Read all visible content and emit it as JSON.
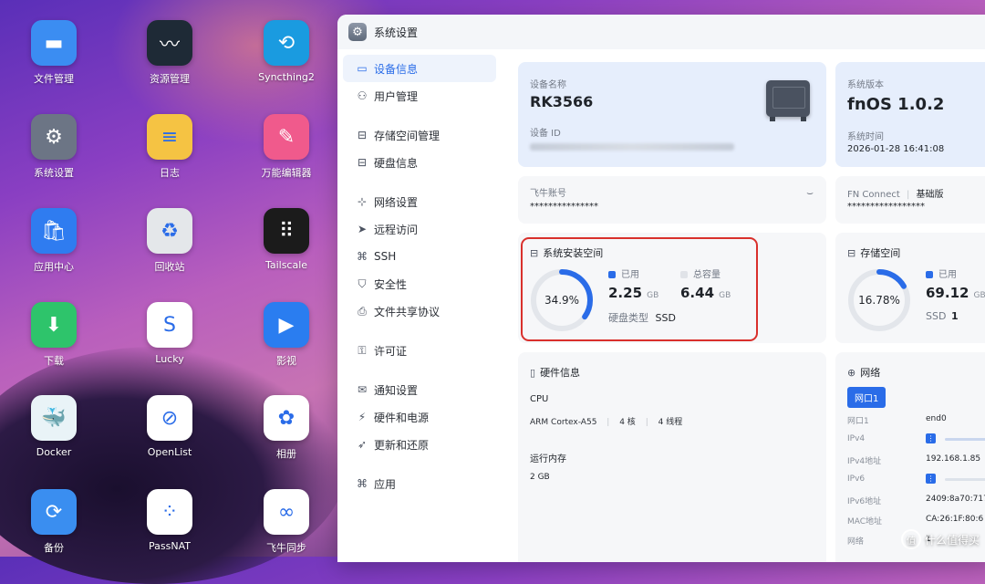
{
  "desktop": {
    "apps": [
      {
        "label": "文件管理",
        "icon": "folder-icon",
        "color": "#3b8df2"
      },
      {
        "label": "资源管理",
        "icon": "activity-monitor-icon",
        "color": "#1e2a36"
      },
      {
        "label": "Syncthing2",
        "icon": "syncthing-icon",
        "color": "#1a9be0"
      },
      {
        "label": "系统设置",
        "icon": "gear-icon",
        "color": "#6c7585"
      },
      {
        "label": "日志",
        "icon": "log-icon",
        "color": "#f5c343"
      },
      {
        "label": "万能编辑器",
        "icon": "editor-icon",
        "color": "#f05a8c"
      },
      {
        "label": "应用中心",
        "icon": "store-icon",
        "color": "#2f7cf0"
      },
      {
        "label": "回收站",
        "icon": "recycle-icon",
        "color": "#e4e7ea"
      },
      {
        "label": "Tailscale",
        "icon": "tailscale-icon",
        "color": "#1b1b1b"
      },
      {
        "label": "下载",
        "icon": "download-icon",
        "color": "#2ec46b"
      },
      {
        "label": "Lucky",
        "icon": "lucky-icon",
        "color": "#ffffff"
      },
      {
        "label": "影视",
        "icon": "video-icon",
        "color": "#2a7df0"
      },
      {
        "label": "Docker",
        "icon": "docker-icon",
        "color": "#e9f3f7"
      },
      {
        "label": "OpenList",
        "icon": "openlist-icon",
        "color": "#ffffff"
      },
      {
        "label": "相册",
        "icon": "photos-icon",
        "color": "#ffffff"
      },
      {
        "label": "备份",
        "icon": "backup-icon",
        "color": "#3a8ef0"
      },
      {
        "label": "PassNAT",
        "icon": "passnat-icon",
        "color": "#ffffff"
      },
      {
        "label": "飞牛同步",
        "icon": "sync-icon",
        "color": "#ffffff"
      }
    ]
  },
  "window": {
    "title": "系统设置"
  },
  "sidebar": {
    "items": [
      {
        "label": "设备信息",
        "icon": "device-icon",
        "glyph": "▭",
        "active": true
      },
      {
        "label": "用户管理",
        "icon": "users-icon",
        "glyph": "⚇",
        "active": false
      },
      {
        "label": "存储空间管理",
        "icon": "storage-icon",
        "glyph": "⊟",
        "active": false
      },
      {
        "label": "硬盘信息",
        "icon": "disk-icon",
        "glyph": "⊟",
        "active": false
      },
      {
        "label": "网络设置",
        "icon": "network-icon",
        "glyph": "⊹",
        "active": false
      },
      {
        "label": "远程访问",
        "icon": "remote-icon",
        "glyph": "➤",
        "active": false
      },
      {
        "label": "SSH",
        "icon": "ssh-icon",
        "glyph": "⌘",
        "active": false
      },
      {
        "label": "安全性",
        "icon": "shield-icon",
        "glyph": "⛉",
        "active": false
      },
      {
        "label": "文件共享协议",
        "icon": "file-share-icon",
        "glyph": "⎙",
        "active": false
      },
      {
        "label": "许可证",
        "icon": "key-icon",
        "glyph": "⚿",
        "active": false
      },
      {
        "label": "通知设置",
        "icon": "mail-icon",
        "glyph": "✉",
        "active": false
      },
      {
        "label": "硬件和电源",
        "icon": "power-icon",
        "glyph": "⚡",
        "active": false
      },
      {
        "label": "更新和还原",
        "icon": "rocket-icon",
        "glyph": "➶",
        "active": false
      },
      {
        "label": "应用",
        "icon": "apps-icon",
        "glyph": "⌘",
        "active": false
      }
    ]
  },
  "device": {
    "name_label": "设备名称",
    "name": "RK3566",
    "id_label": "设备 ID"
  },
  "system": {
    "version_label": "系统版本",
    "version": "fnOS 1.0.2",
    "time_label": "系统时间",
    "time": "2026-01-28 16:41:08"
  },
  "account": {
    "label": "飞牛账号",
    "value": "***************"
  },
  "fnconnect": {
    "label": "FN Connect",
    "tier": "基础版",
    "value": "*****************"
  },
  "sys_space": {
    "title": "系统安装空间",
    "percent_text": "34.9%",
    "percent": 0.349,
    "used_label": "已用",
    "used_value": "2.25",
    "used_unit": "GB",
    "total_label": "总容量",
    "total_value": "6.44",
    "total_unit": "GB",
    "disk_type_label": "硬盘类型",
    "disk_type": "SSD",
    "ring_color": "#2a6ce8",
    "ring_track": "#e3e6eb"
  },
  "storage": {
    "title": "存储空间",
    "percent_text": "16.78%",
    "percent": 0.1678,
    "used_label": "已用",
    "used_value": "69.12",
    "used_unit": "GB",
    "ssd_label": "SSD",
    "ssd_count": "1"
  },
  "hardware": {
    "title": "硬件信息",
    "cpu_label": "CPU",
    "cpu_model": "ARM Cortex-A55",
    "cores": "4 核",
    "threads": "4 线程",
    "mem_label": "运行内存",
    "mem_value": "2 GB"
  },
  "network": {
    "title": "网络",
    "tab": "网口1",
    "rows": [
      {
        "label": "网口1",
        "value": "end0"
      },
      {
        "label": "IPv4",
        "value": ""
      },
      {
        "label": "IPv4地址",
        "value": "192.168.1.85"
      },
      {
        "label": "IPv6",
        "value": ""
      },
      {
        "label": "IPv6地址",
        "value": "2409:8a70:717"
      },
      {
        "label": "MAC地址",
        "value": "CA:26:1F:80:6"
      },
      {
        "label": "网络",
        "value": "1"
      }
    ]
  },
  "watermark": {
    "text": "什么值得买",
    "logo": "值"
  },
  "colors": {
    "accent": "#2a6ce8",
    "highlight_border": "#d9302c"
  }
}
